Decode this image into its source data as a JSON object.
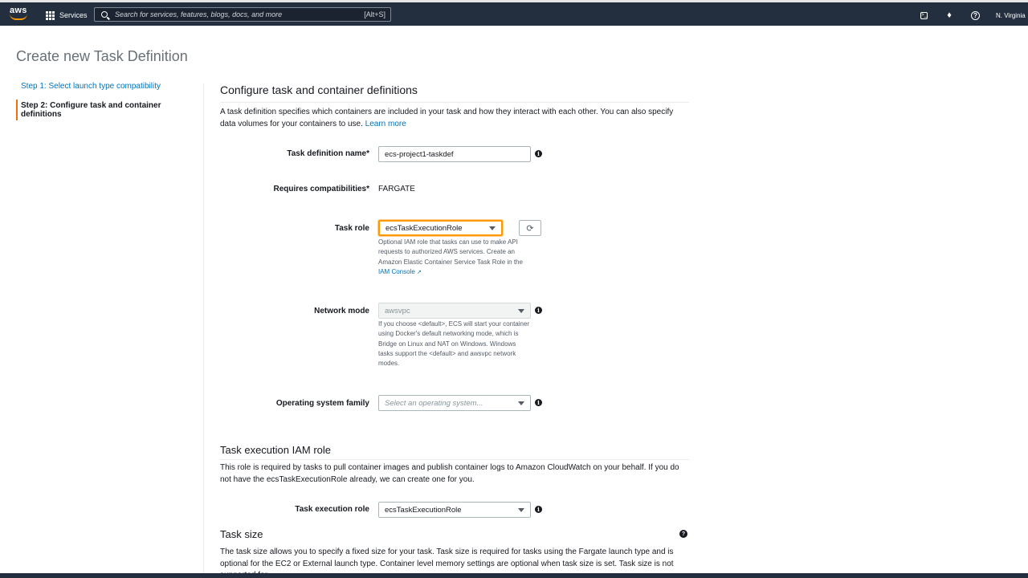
{
  "topbar": {
    "logo": "aws",
    "services_label": "Services",
    "search_placeholder": "Search for services, features, blogs, docs, and more",
    "search_shortcut": "[Alt+S]",
    "icons": [
      "cloudshell-icon",
      "bell-icon",
      "help-icon"
    ],
    "region": "N. Virginia"
  },
  "page": {
    "title": "Create new Task Definition"
  },
  "steps": [
    {
      "label": "Step 1: Select launch type compatibility",
      "state": "link"
    },
    {
      "label": "Step 2: Configure task and container definitions",
      "state": "active"
    }
  ],
  "configure": {
    "title": "Configure task and container definitions",
    "description": "A task definition specifies which containers are included in your task and how they interact with each other. You can also specify data volumes for your containers to use.",
    "learn_more": "Learn more",
    "task_def_name": {
      "label": "Task definition name*",
      "value": "ecs-project1-taskdef"
    },
    "compat": {
      "label": "Requires compatibilities*",
      "value": "FARGATE"
    },
    "task_role": {
      "label": "Task role",
      "value": "ecsTaskExecutionRole",
      "help": "Optional IAM role that tasks can use to make API requests to authorized AWS services. Create an Amazon Elastic Container Service Task Role in the",
      "help_link": "IAM Console"
    },
    "network_mode": {
      "label": "Network mode",
      "value": "awsvpc",
      "help": "If you choose <default>, ECS will start your container using Docker's default networking mode, which is Bridge on Linux and NAT on Windows. Windows tasks support the <default> and awsvpc network modes."
    },
    "os_family": {
      "label": "Operating system family",
      "placeholder": "Select an operating system..."
    }
  },
  "exec_role": {
    "title": "Task execution IAM role",
    "description": "This role is required by tasks to pull container images and publish container logs to Amazon CloudWatch on your behalf. If you do not have the ecsTaskExecutionRole already, we can create one for you.",
    "label": "Task execution role",
    "value": "ecsTaskExecutionRole"
  },
  "task_size": {
    "title": "Task size",
    "description": "The task size allows you to specify a fixed size for your task. Task size is required for tasks using the Fargate launch type and is optional for the EC2 or External launch type. Container level memory settings are optional when task size is set. Task size is not supported for"
  },
  "colors": {
    "nav": "#232f3e",
    "accent": "#ec7211",
    "link": "#0073bb",
    "focus": "#ff9900"
  }
}
